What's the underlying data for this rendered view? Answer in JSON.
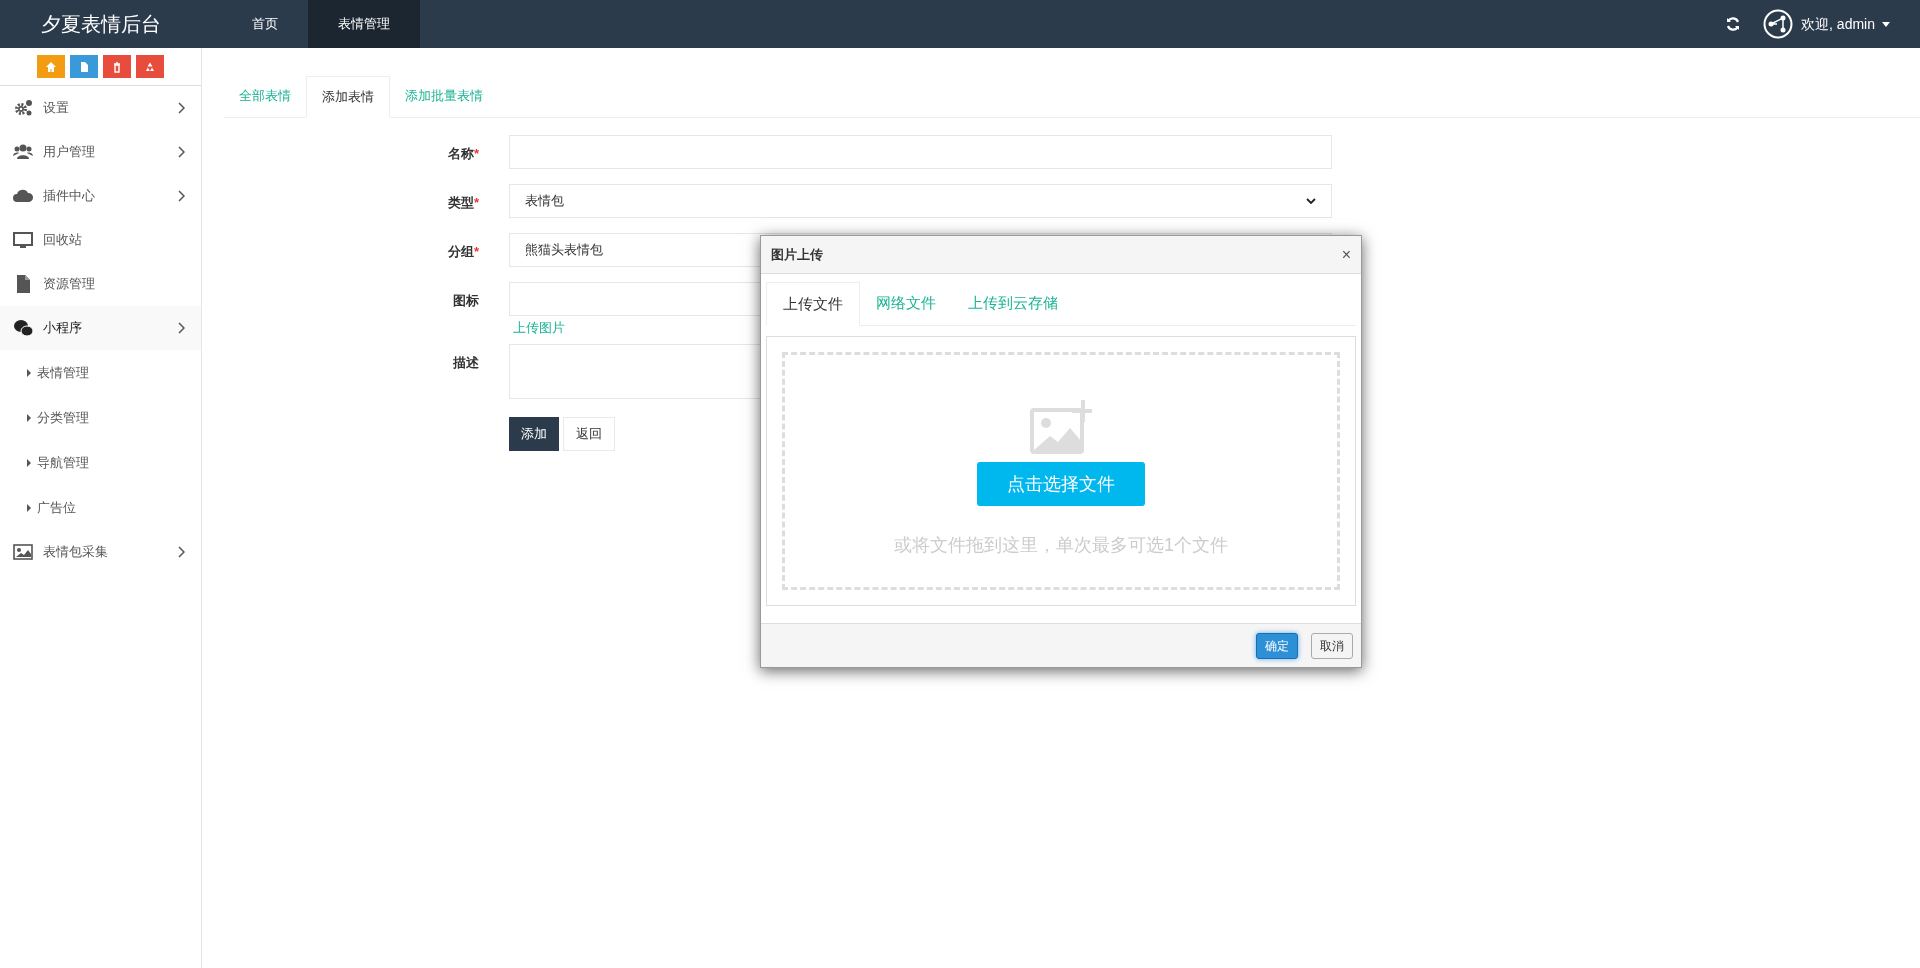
{
  "app": {
    "title": "夕夏表情后台"
  },
  "nav": [
    {
      "label": "首页",
      "selected": false
    },
    {
      "label": "表情管理",
      "selected": true
    }
  ],
  "user": {
    "greeting": "欢迎, admin"
  },
  "quick_buttons": [
    {
      "kind": "home",
      "color": "#f39c12"
    },
    {
      "kind": "file",
      "color": "#3a9ad9"
    },
    {
      "kind": "trash",
      "color": "#e74c3c"
    },
    {
      "kind": "recycle",
      "color": "#e74c3c"
    }
  ],
  "sidebar": {
    "items": [
      {
        "kind": "gears",
        "label": "设置",
        "submenu": true,
        "selected": false
      },
      {
        "kind": "users",
        "label": "用户管理",
        "submenu": true,
        "selected": false
      },
      {
        "kind": "cloud",
        "label": "插件中心",
        "submenu": true,
        "selected": false
      },
      {
        "kind": "monitor",
        "label": "回收站",
        "submenu": false,
        "selected": false
      },
      {
        "kind": "file",
        "label": "资源管理",
        "submenu": false,
        "selected": false
      },
      {
        "kind": "chat",
        "label": "小程序",
        "submenu": true,
        "selected": true,
        "children": [
          {
            "label": "表情管理"
          },
          {
            "label": "分类管理"
          },
          {
            "label": "导航管理"
          },
          {
            "label": "广告位"
          }
        ]
      },
      {
        "kind": "image",
        "label": "表情包采集",
        "submenu": true,
        "selected": false
      }
    ]
  },
  "tabs": [
    {
      "label": "全部表情",
      "selected": false
    },
    {
      "label": "添加表情",
      "selected": true
    },
    {
      "label": "添加批量表情",
      "selected": false
    }
  ],
  "form": {
    "fields": [
      {
        "kind": "text",
        "label": "名称",
        "required_mark": "*"
      },
      {
        "kind": "select",
        "label": "类型",
        "required_mark": "*",
        "value": "表情包"
      },
      {
        "kind": "filled",
        "label": "分组",
        "required_mark": "*",
        "value": "熊猫头表情包"
      },
      {
        "kind": "upload",
        "label": "图标",
        "link": "上传图片"
      },
      {
        "kind": "textarea",
        "label": "描述"
      }
    ],
    "buttons": [
      {
        "label": "添加",
        "kind": "primary"
      },
      {
        "label": "返回",
        "kind": "default"
      }
    ]
  },
  "dialog": {
    "title": "图片上传",
    "close": "×",
    "tabs": [
      {
        "label": "上传文件",
        "selected": true
      },
      {
        "label": "网络文件",
        "selected": false
      },
      {
        "label": "上传到云存储",
        "selected": false
      }
    ],
    "pick_button": "点击选择文件",
    "hint": "或将文件拖到这里，单次最多可选1个文件",
    "buttons": [
      {
        "label": "确定",
        "kind": "primary"
      },
      {
        "label": "取消",
        "kind": "default"
      }
    ]
  }
}
